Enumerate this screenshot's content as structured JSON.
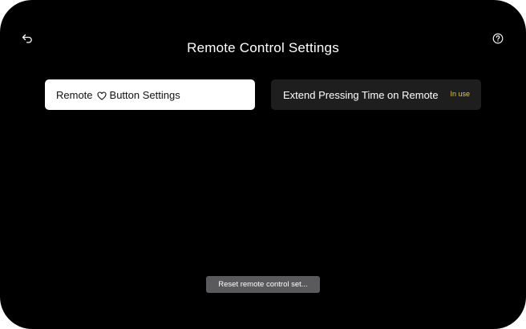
{
  "header": {
    "title": "Remote Control Settings",
    "back_icon": "back-arrow-icon",
    "help_icon": "help-icon"
  },
  "cards": {
    "remote_button": {
      "label_before": "Remote",
      "icon": "heart-icon",
      "label_after": "Button Settings"
    },
    "extend_pressing": {
      "label": "Extend Pressing Time on Remote",
      "badge": "In use"
    }
  },
  "footer": {
    "reset_label": "Reset remote control set..."
  },
  "colors": {
    "background": "#000000",
    "selected_card": "#ffffff",
    "card": "#1e1e1e",
    "badge": "#e8c25a",
    "reset_button": "#5a5a5c"
  }
}
